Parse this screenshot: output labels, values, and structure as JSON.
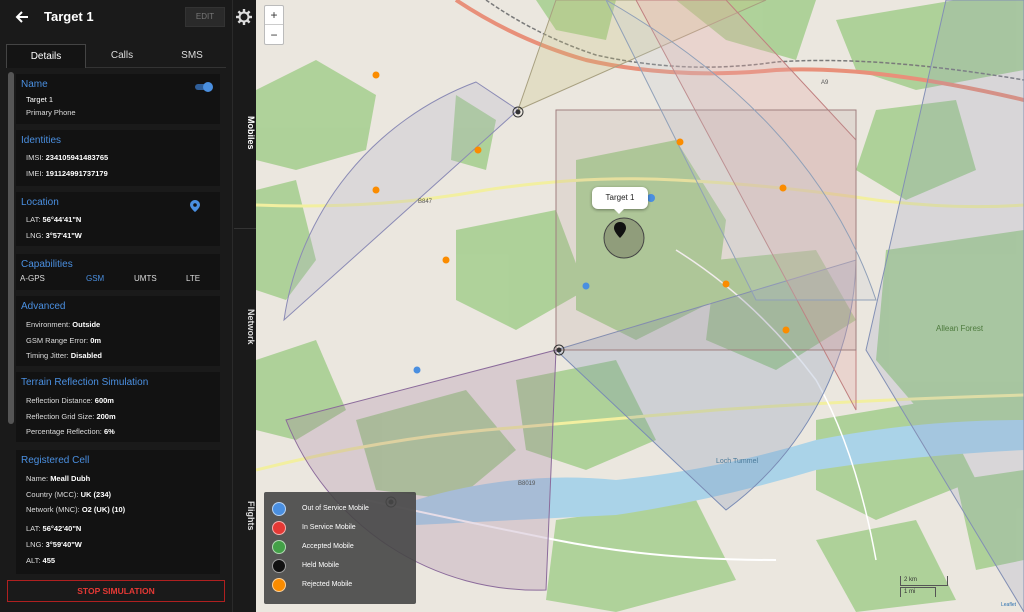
{
  "header": {
    "title": "Target 1",
    "edit_label": "EDIT"
  },
  "tabs": [
    {
      "label": "Details"
    },
    {
      "label": "Calls"
    },
    {
      "label": "SMS"
    }
  ],
  "side_tabs": {
    "mobiles": "Mobiles",
    "network": "Network",
    "flights": "Flights"
  },
  "name_card": {
    "title": "Name",
    "name": "Target 1",
    "subtitle": "Primary Phone"
  },
  "identities": {
    "title": "Identities",
    "imsi_label": "IMSI:",
    "imsi": "234105941483765",
    "imei_label": "IMEI:",
    "imei": "191124991737179"
  },
  "location": {
    "title": "Location",
    "lat_label": "LAT:",
    "lat": "56°44'41\"N",
    "lng_label": "LNG:",
    "lng": "3°57'41\"W"
  },
  "capabilities": {
    "title": "Capabilities",
    "items": [
      "A-GPS",
      "GSM",
      "UMTS",
      "LTE"
    ]
  },
  "advanced": {
    "title": "Advanced",
    "environment_label": "Environment:",
    "environment": "Outside",
    "gsm_label": "GSM Range Error:",
    "gsm": "0m",
    "jitter_label": "Timing Jitter:",
    "jitter": "Disabled"
  },
  "terrain": {
    "title": "Terrain Reflection Simulation",
    "distance_label": "Reflection Distance:",
    "distance": "600m",
    "grid_label": "Reflection Grid Size:",
    "grid": "200m",
    "percent_label": "Percentage Reflection:",
    "percent": "6%"
  },
  "registered_cell": {
    "title": "Registered Cell",
    "name_label": "Name:",
    "name": "Meall Dubh",
    "country_label": "Country (MCC):",
    "country": "UK (234)",
    "network_label": "Network (MNC):",
    "network": "O2 (UK) (10)",
    "lat_label": "LAT:",
    "lat": "56°42'40\"N",
    "lng_label": "LNG:",
    "lng": "3°59'40\"W",
    "alt_label": "ALT:",
    "alt": "455"
  },
  "stop_label": "STOP SIMULATION",
  "map": {
    "zoom_in": "+",
    "zoom_out": "−",
    "popup": "Target 1",
    "place_label": "Loch Tummel",
    "forest_label": "Allean Forest",
    "road_b847": "B847",
    "road_b8019": "B8019",
    "road_a9": "A9",
    "scale_km": "2 km",
    "scale_mi": "1 mi",
    "attribution": "Leaflet"
  },
  "legend": [
    {
      "label": "Out of Service Mobile",
      "color": "#4a8fe0"
    },
    {
      "label": "In Service Mobile",
      "color": "#e53935"
    },
    {
      "label": "Accepted Mobile",
      "color": "#43a047"
    },
    {
      "label": "Held Mobile",
      "color": "#111111"
    },
    {
      "label": "Rejected Mobile",
      "color": "#fb8c00"
    }
  ],
  "colors": {
    "accent": "#4a8fe0",
    "danger": "#e53935",
    "panel": "#1a1a1a"
  }
}
